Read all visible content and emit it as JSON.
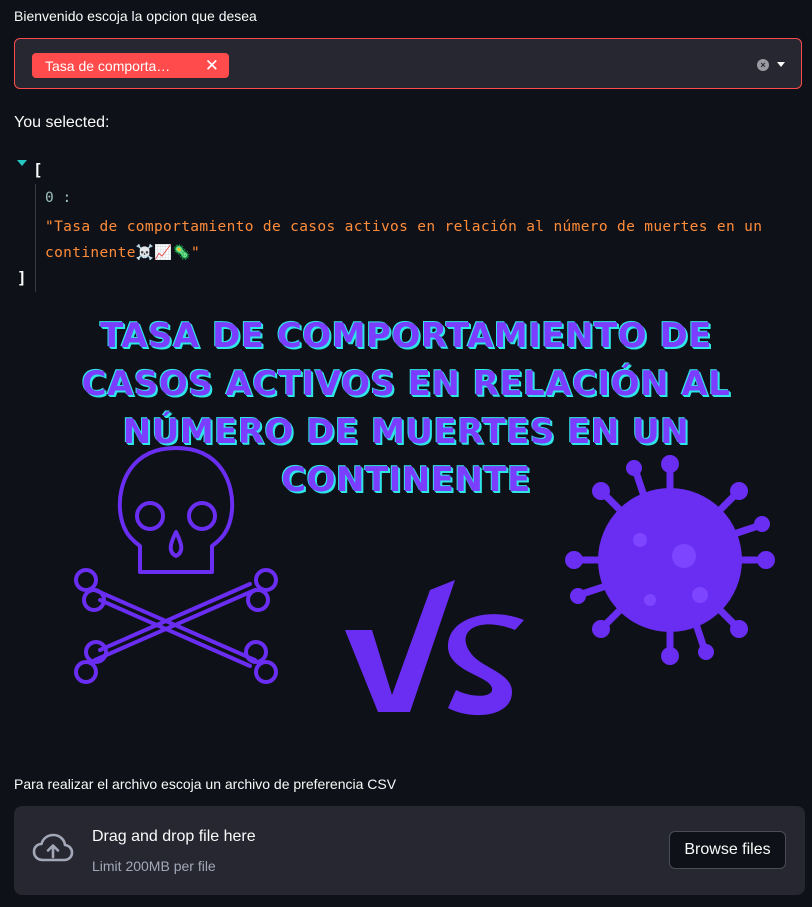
{
  "selector": {
    "label": "Bienvenido escoja la opcion que desea",
    "selected_chip": "Tasa de comporta…",
    "chip_remove_glyph": "✕",
    "clear_glyph": "×"
  },
  "output": {
    "heading": "You selected:",
    "json_open": "[",
    "json_close": "]",
    "items": [
      {
        "index_label": "0 :",
        "value": "\"Tasa de comportamiento de casos activos en relación al número de muertes en un continente☠️📈🦠\""
      }
    ]
  },
  "banner": {
    "title": "TASA DE COMPORTAMIENTO DE CASOS ACTIVOS EN RELACIÓN AL NÚMERO DE MUERTES EN UN CONTINENTE",
    "vs_text": "VS",
    "accent_color": "#7b3dff",
    "outline_color": "#2ee6e6",
    "icons": [
      "skull-crossbones-icon",
      "virus-icon"
    ]
  },
  "uploader": {
    "label": "Para realizar el archivo escoja un archivo de preferencia CSV",
    "drop_title": "Drag and drop file here",
    "limit_text": "Limit 200MB per file",
    "browse_label": "Browse files",
    "icon": "cloud-upload-icon"
  },
  "colors": {
    "background": "#0e1117",
    "accent": "#ff4b4b",
    "panel": "#262730",
    "json_string": "#ff8c3a"
  }
}
